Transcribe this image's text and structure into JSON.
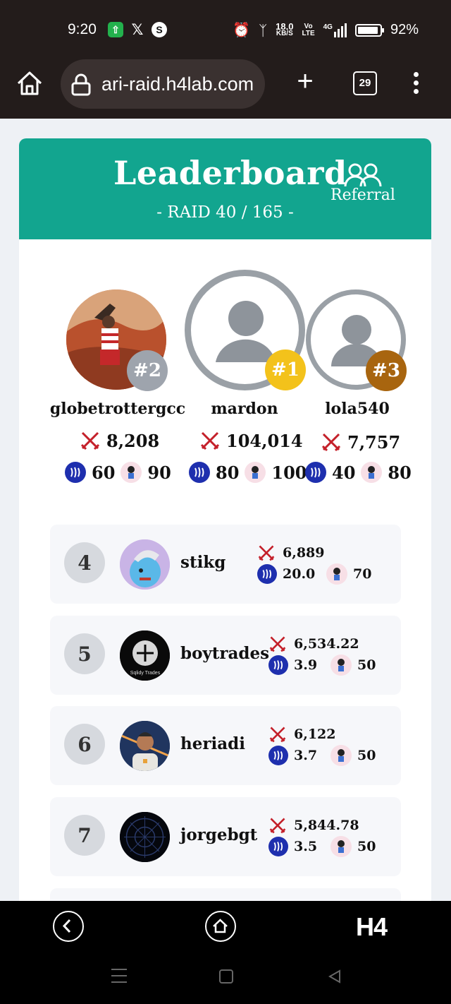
{
  "status_bar": {
    "time": "9:20",
    "net_speed_value": "18.0",
    "net_speed_unit": "KB/S",
    "volte_top": "Vo",
    "volte_bottom": "LTE",
    "signal_label": "4G",
    "battery": "92%"
  },
  "browser": {
    "url": "ari-raid.h4lab.com",
    "tab_count": "29"
  },
  "header": {
    "title": "Leaderboard",
    "subtitle": "- RAID 40 / 165 -",
    "referral_label": "Referral",
    "bg_color": "#12a58f"
  },
  "podium": [
    {
      "rank_label": "#2",
      "name": "globetrottergcc",
      "damage": "8,208",
      "steem": "60",
      "char_value": "90",
      "badge_color": "#9ea4ad"
    },
    {
      "rank_label": "#1",
      "name": "mardon",
      "damage": "104,014",
      "steem": "80",
      "char_value": "100",
      "badge_color": "#f3c21b"
    },
    {
      "rank_label": "#3",
      "name": "lola540",
      "damage": "7,757",
      "steem": "40",
      "char_value": "80",
      "badge_color": "#a8650f"
    }
  ],
  "rows": [
    {
      "rank": "4",
      "name": "stikg",
      "damage": "6,889",
      "steem": "20.0",
      "char_value": "70"
    },
    {
      "rank": "5",
      "name": "boytrades",
      "damage": "6,534.22",
      "steem": "3.9",
      "char_value": "50",
      "avatar_text": "Sqlidy Trades"
    },
    {
      "rank": "6",
      "name": "heriadi",
      "damage": "6,122",
      "steem": "3.7",
      "char_value": "50"
    },
    {
      "rank": "7",
      "name": "jorgebgt",
      "damage": "5,844.78",
      "steem": "3.5",
      "char_value": "50"
    }
  ],
  "bottom_nav": {
    "logo": "H4"
  },
  "icons": {
    "damage": "crossed-swords-icon",
    "currency": "steem-icon",
    "reward": "character-icon"
  }
}
